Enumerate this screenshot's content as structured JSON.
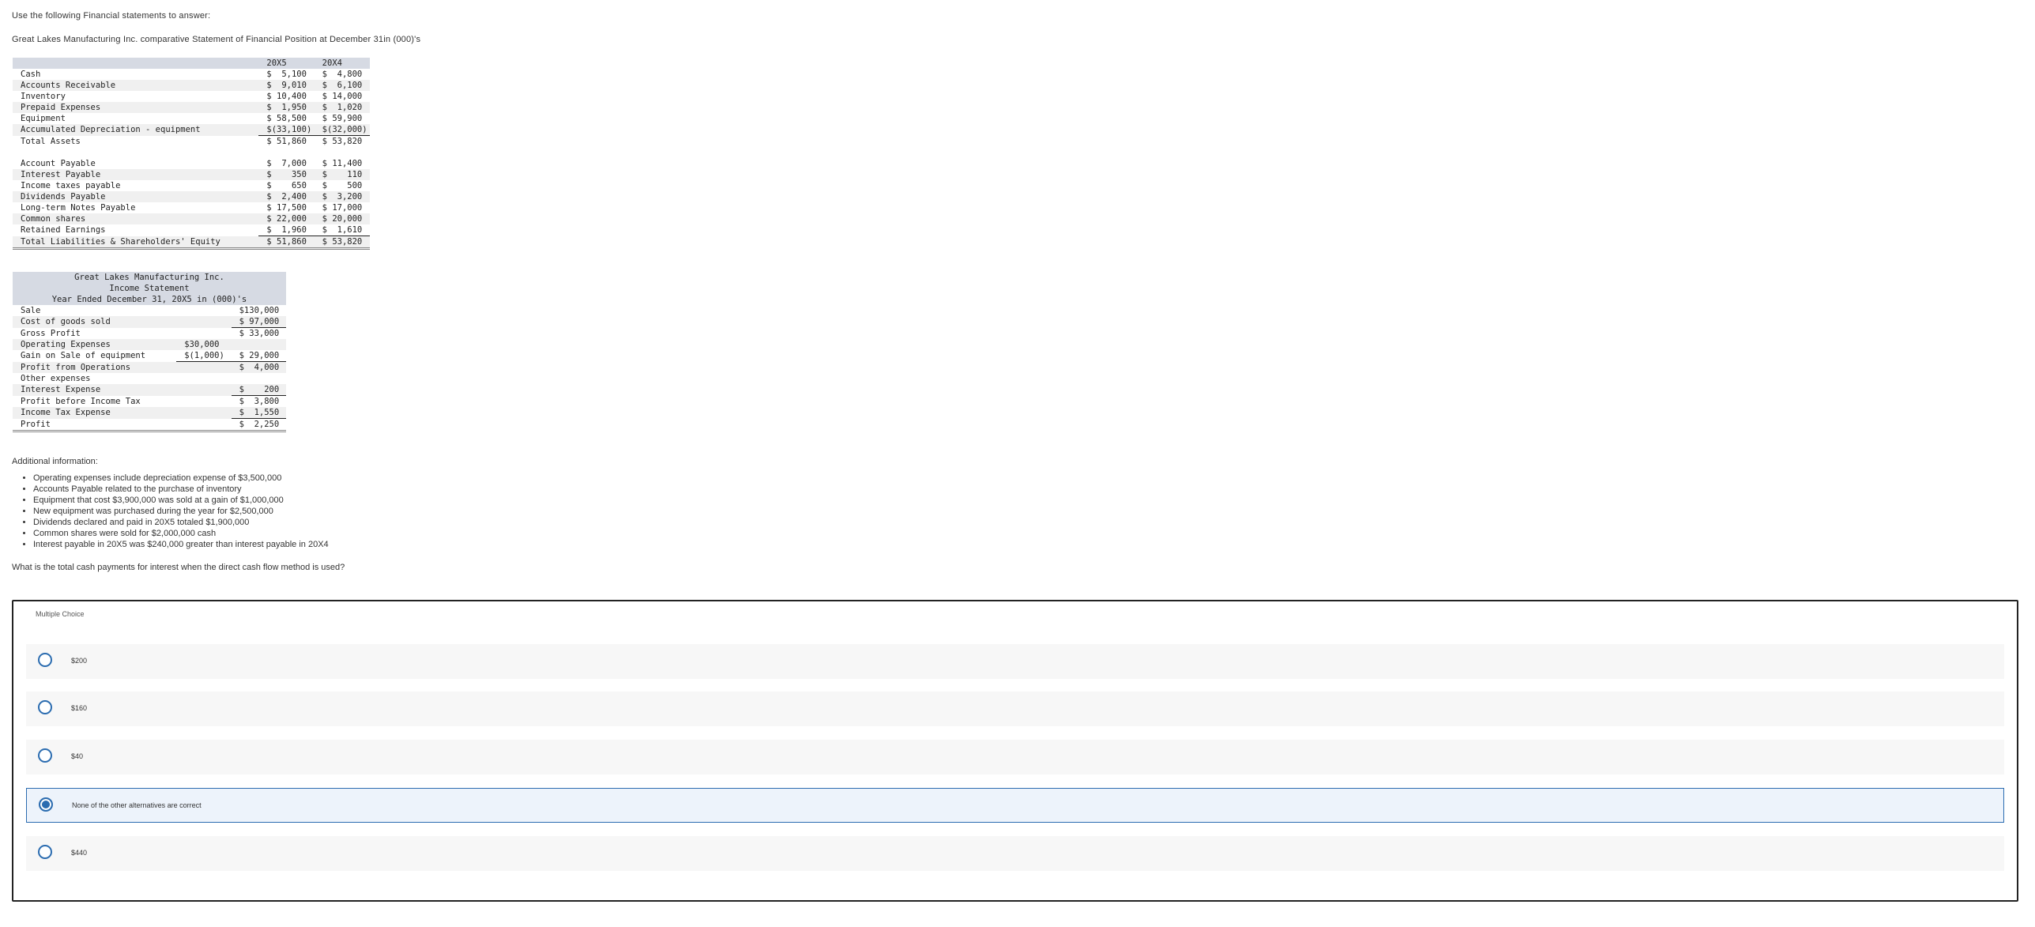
{
  "intro": "Use the following Financial statements to answer:",
  "subtitle": "Great Lakes Manufacturing Inc. comparative Statement of Financial Position at December 31in (000)'s",
  "balance": {
    "headers": [
      "",
      "20X5",
      "20X4"
    ],
    "rows": [
      [
        "Cash",
        "$  5,100",
        "$  4,800"
      ],
      [
        "Accounts Receivable",
        "$  9,010",
        "$  6,100"
      ],
      [
        "Inventory",
        "$ 10,400",
        "$ 14,000"
      ],
      [
        "Prepaid Expenses",
        "$  1,950",
        "$  1,020"
      ],
      [
        "Equipment",
        "$ 58,500",
        "$ 59,900"
      ],
      [
        "Accumulated Depreciation - equipment",
        "$(33,100)",
        "$(32,000)"
      ],
      [
        "Total Assets",
        "$ 51,860",
        "$ 53,820"
      ],
      [
        "",
        "",
        ""
      ],
      [
        "Account Payable",
        "$  7,000",
        "$ 11,400"
      ],
      [
        "Interest Payable",
        "$    350",
        "$    110"
      ],
      [
        "Income taxes payable",
        "$    650",
        "$    500"
      ],
      [
        "Dividends Payable",
        "$  2,400",
        "$  3,200"
      ],
      [
        "Long-term Notes Payable",
        "$ 17,500",
        "$ 17,000"
      ],
      [
        "Common shares",
        "$ 22,000",
        "$ 20,000"
      ],
      [
        "Retained Earnings",
        "$  1,960",
        "$  1,610"
      ],
      [
        "Total Liabilities & Shareholders' Equity",
        "$ 51,860",
        "$ 53,820"
      ]
    ]
  },
  "income": {
    "title1": "Great Lakes Manufacturing Inc.",
    "title2": "Income Statement",
    "title3": "Year Ended December 31, 20X5 in (000)'s",
    "rows": [
      [
        "Sale",
        "",
        "$130,000"
      ],
      [
        "Cost of goods sold",
        "",
        "$ 97,000"
      ],
      [
        "Gross Profit",
        "",
        "$ 33,000"
      ],
      [
        "Operating Expenses",
        "$30,000",
        ""
      ],
      [
        "Gain on Sale of equipment",
        "$(1,000)",
        "$ 29,000"
      ],
      [
        "Profit from Operations",
        "",
        "$  4,000"
      ],
      [
        "Other expenses",
        "",
        ""
      ],
      [
        "Interest Expense",
        "",
        "$    200"
      ],
      [
        "Profit before Income Tax",
        "",
        "$  3,800"
      ],
      [
        "Income Tax Expense",
        "",
        "$  1,550"
      ],
      [
        "Profit",
        "",
        "$  2,250"
      ]
    ]
  },
  "additional_label": "Additional information:",
  "additional_items": [
    "Operating expenses include depreciation expense of $3,500,000",
    "Accounts Payable related to the purchase of inventory",
    "Equipment that cost $3,900,000 was sold at a gain of $1,000,000",
    "New equipment was purchased during the year for $2,500,000",
    "Dividends declared and paid in 20X5 totaled $1,900,000",
    "Common shares were sold for $2,000,000 cash",
    "Interest payable in 20X5 was $240,000 greater than interest payable in 20X4"
  ],
  "question": "What is the total cash payments for interest when the direct cash flow method is used?",
  "mc": {
    "label": "Multiple Choice",
    "options": [
      {
        "text": "$200",
        "selected": false
      },
      {
        "text": "$160",
        "selected": false
      },
      {
        "text": "$40",
        "selected": false
      },
      {
        "text": "None of the other alternatives are correct",
        "selected": true
      },
      {
        "text": "$440",
        "selected": false
      }
    ]
  },
  "colors": {
    "accent": "#2b6cb0",
    "table_header": "#d6dae3"
  }
}
